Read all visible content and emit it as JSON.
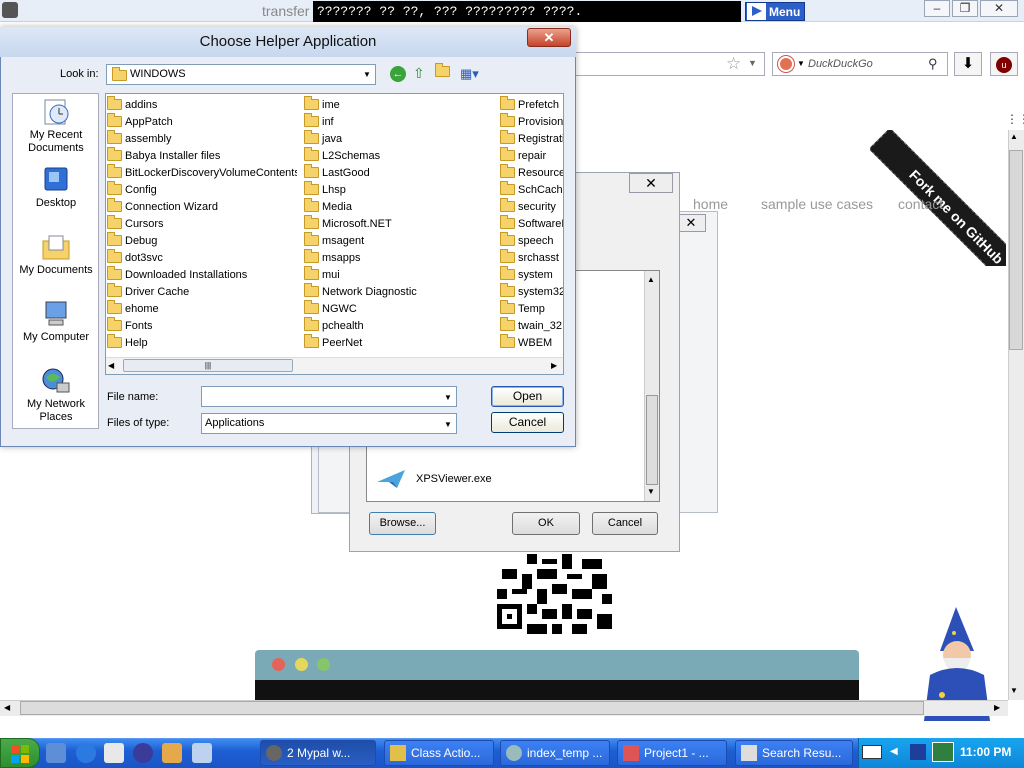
{
  "browser": {
    "title_fragment": "transfer",
    "marquee": "??????? ?? ??, ??? ????????? ????.",
    "menu_label": "Menu",
    "search_placeholder": "DuckDuckGo",
    "window_buttons": [
      "–",
      "❐",
      "✕"
    ]
  },
  "page": {
    "nav": [
      "home",
      "sample use cases",
      "contact"
    ],
    "ribbon": "Fork me on GitHub",
    "window_dot_colors": [
      "#e5645a",
      "#e7d65c",
      "#86c56b"
    ]
  },
  "open_with_dialog": {
    "list_item": "XPSViewer.exe",
    "browse_label": "Browse...",
    "ok_label": "OK",
    "cancel_label": "Cancel"
  },
  "helper_dialog": {
    "title": "Choose Helper Application",
    "look_in_label": "Look in:",
    "look_in_value": "WINDOWS",
    "places": [
      "My Recent Documents",
      "Desktop",
      "My Documents",
      "My Computer",
      "My Network Places"
    ],
    "columns": [
      [
        "addins",
        "AppPatch",
        "assembly",
        "Babya Installer files",
        "BitLockerDiscoveryVolumeContents",
        "Config",
        "Connection Wizard",
        "Cursors",
        "Debug",
        "dot3svc",
        "Downloaded Installations",
        "Driver Cache",
        "ehome",
        "Fonts",
        "Help"
      ],
      [
        "ime",
        "inf",
        "java",
        "L2Schemas",
        "LastGood",
        "Lhsp",
        "Media",
        "Microsoft.NET",
        "msagent",
        "msapps",
        "mui",
        "Network Diagnostic",
        "NGWC",
        "pchealth",
        "PeerNet"
      ],
      [
        "Prefetch",
        "Provisioni",
        "Registrati",
        "repair",
        "Resource:",
        "SchCache",
        "security",
        "SoftwareD",
        "speech",
        "srchasst",
        "system",
        "system32",
        "Temp",
        "twain_32",
        "WBEM"
      ]
    ],
    "file_name_label": "File name:",
    "file_name_value": "",
    "files_of_type_label": "Files of type:",
    "files_of_type_value": "Applications",
    "open_label": "Open",
    "cancel_label": "Cancel"
  },
  "taskbar": {
    "tasks": [
      "2 Mypal w...",
      "Class Actio...",
      "index_temp ...",
      "Project1 - ...",
      "Search Resu..."
    ],
    "clock": "11:00 PM"
  }
}
